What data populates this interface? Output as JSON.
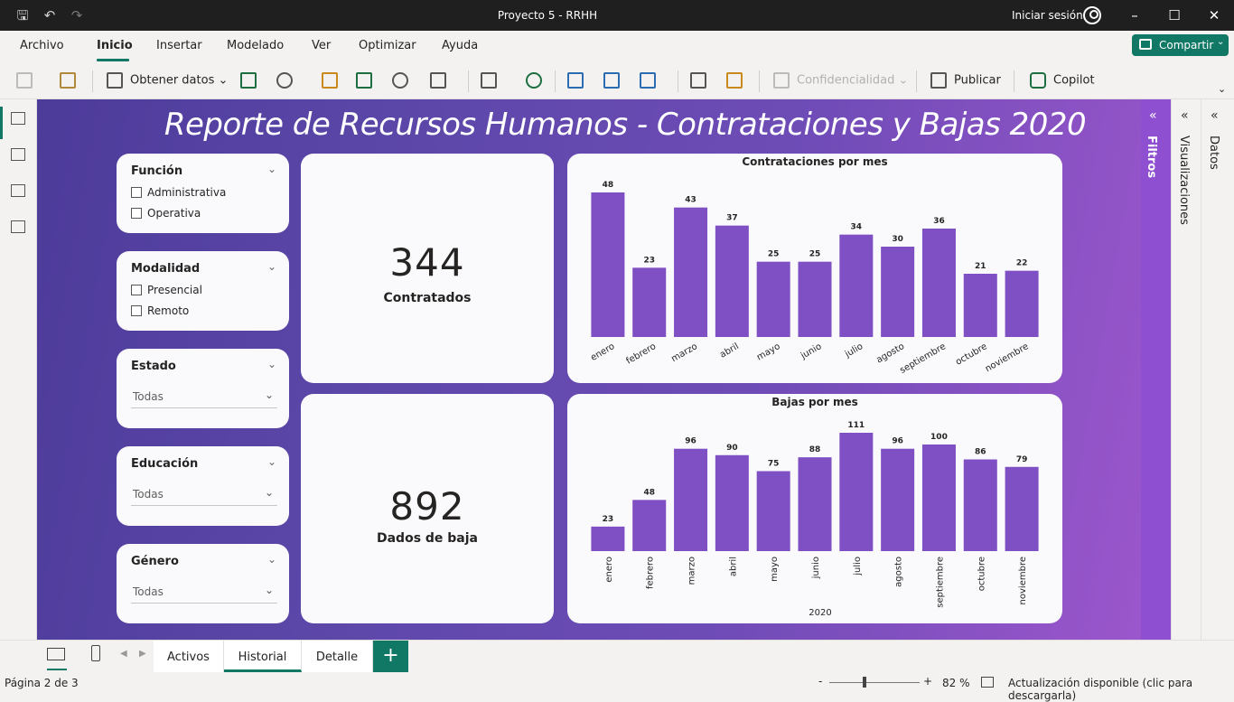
{
  "window": {
    "title": "Proyecto 5 - RRHH",
    "signin": "Iniciar sesión"
  },
  "menu": {
    "items": [
      "Archivo",
      "Inicio",
      "Insertar",
      "Modelado",
      "Ver",
      "Optimizar",
      "Ayuda"
    ],
    "share": "Compartir"
  },
  "ribbon": {
    "get_data": "Obtener datos",
    "sensitivity": "Confidencialidad",
    "publish": "Publicar",
    "copilot": "Copilot"
  },
  "report": {
    "title": "Reporte de Recursos Humanos - Contrataciones y Bajas 2020"
  },
  "slicers": [
    {
      "title": "Función",
      "options": [
        "Administrativa",
        "Operativa"
      ]
    },
    {
      "title": "Modalidad",
      "options": [
        "Presencial",
        "Remoto"
      ]
    },
    {
      "title": "Estado",
      "selected": "Todas"
    },
    {
      "title": "Educación",
      "selected": "Todas"
    },
    {
      "title": "Género",
      "selected": "Todas"
    }
  ],
  "kpis": {
    "hired": {
      "value": "344",
      "label": "Contratados"
    },
    "left": {
      "value": "892",
      "label": "Dados de baja"
    }
  },
  "chart_data": [
    {
      "type": "bar",
      "title": "Contrataciones por mes",
      "categories": [
        "enero",
        "febrero",
        "marzo",
        "abril",
        "mayo",
        "junio",
        "julio",
        "agosto",
        "septiembre",
        "octubre",
        "noviembre"
      ],
      "values": [
        48,
        23,
        43,
        37,
        25,
        25,
        34,
        30,
        36,
        21,
        22
      ],
      "xlabel": "",
      "ylabel": "",
      "color": "#7f4fc4"
    },
    {
      "type": "bar",
      "title": "Bajas por mes",
      "categories": [
        "enero",
        "febrero",
        "marzo",
        "abril",
        "mayo",
        "junio",
        "julio",
        "agosto",
        "septiembre",
        "octubre",
        "noviembre"
      ],
      "values": [
        23,
        48,
        96,
        90,
        75,
        88,
        111,
        96,
        100,
        86,
        79
      ],
      "xlabel": "2020",
      "ylabel": "",
      "color": "#7f4fc4"
    }
  ],
  "panels": {
    "filters": "Filtros",
    "visualizations": "Visualizaciones",
    "data": "Datos"
  },
  "tabs": {
    "items": [
      "Activos",
      "Historial",
      "Detalle"
    ],
    "active": "Historial"
  },
  "status": {
    "page": "Página 2 de 3",
    "zoom": "82 %",
    "update": "Actualización disponible (clic para descargarla)"
  }
}
